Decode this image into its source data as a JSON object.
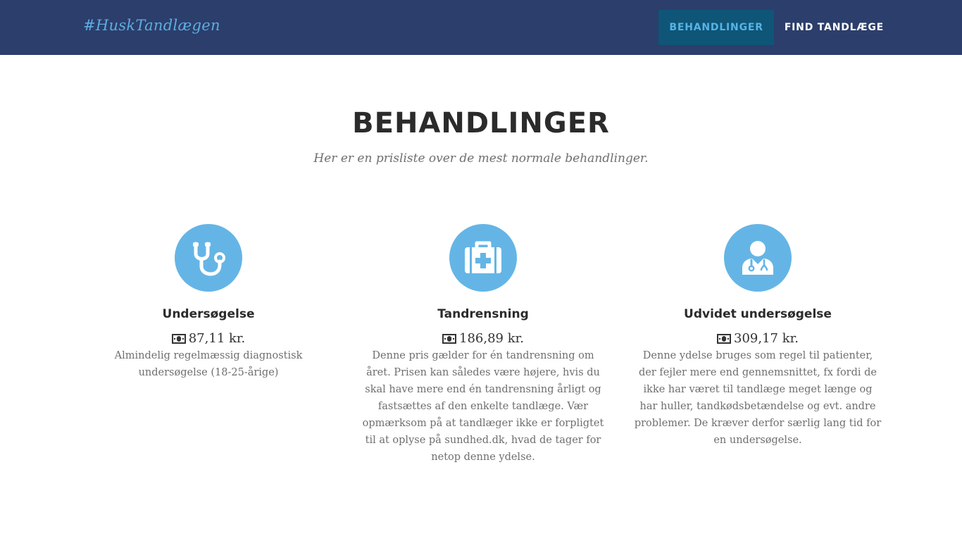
{
  "navbar": {
    "brand": "#HuskTandlægen",
    "links": [
      {
        "label": "BEHANDLINGER",
        "active": true
      },
      {
        "label": "FIND TANDLÆGE",
        "active": false
      }
    ]
  },
  "section": {
    "title": "BEHANDLINGER",
    "subtitle": "Her er en prisliste over de mest normale behandlinger."
  },
  "services": [
    {
      "icon": "stethoscope-icon",
      "title": "Undersøgelse",
      "price": "87,11 kr.",
      "description": "Almindelig regelmæssig diagnostisk undersøgelse (18-25-årige)"
    },
    {
      "icon": "medkit-icon",
      "title": "Tandrensning",
      "price": "186,89 kr.",
      "description": "Denne pris gælder for én tandrensning om året. Prisen kan således være højere, hvis du skal have mere end én tandrensning årligt og fastsættes af den enkelte tandlæge. Vær opmærksom på at tandlæger ikke er forpligtet til at oplyse på sundhed.dk, hvad de tager for netop denne ydelse."
    },
    {
      "icon": "user-md-icon",
      "title": "Udvidet undersøgelse",
      "price": "309,17 kr.",
      "description": "Denne ydelse bruges som regel til patienter, der fejler mere end gennemsnittet, fx fordi de ikke har været til tandlæge meget længe og har huller, tandkødsbetændelse og evt. andre problemer. De kræver derfor særlig lang tid for en undersøgelse."
    }
  ],
  "colors": {
    "navbar_bg": "#2c3e6b",
    "accent": "#64b5e6",
    "active_nav_bg": "#0f5577"
  }
}
